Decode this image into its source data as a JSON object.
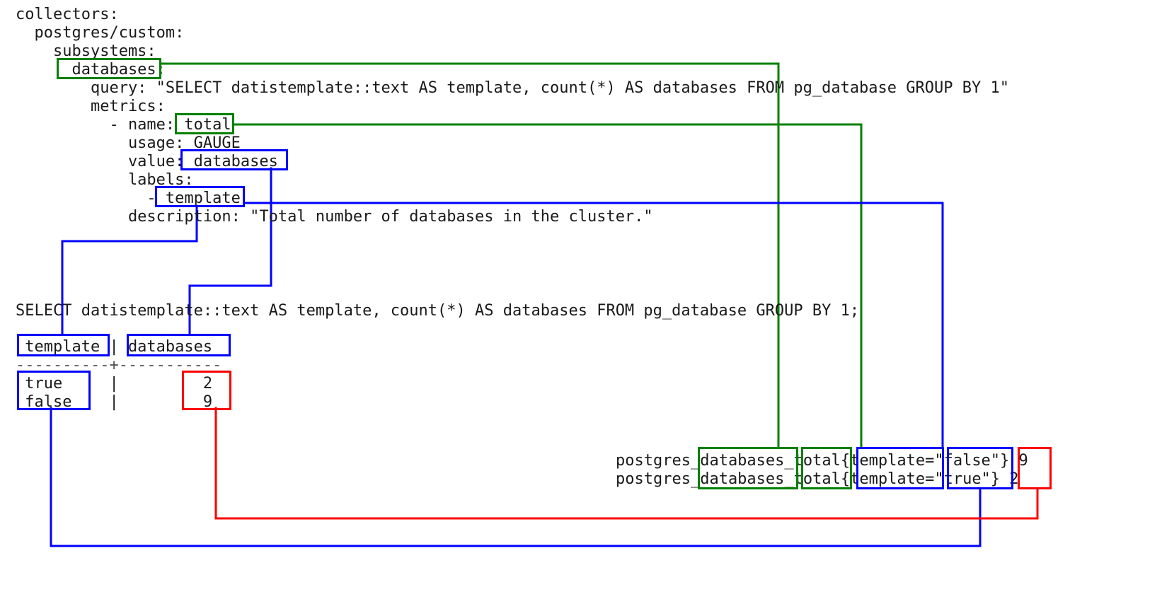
{
  "diagram": {
    "title": "PostgreSQL custom collector YAML to SQL result to Prometheus metric mapping",
    "colors": {
      "green": "#008000",
      "blue": "#0000ff",
      "red": "#ff0000",
      "text": "#1a1a1a",
      "background": "#ffffff"
    }
  },
  "yaml": {
    "lines": [
      "collectors:",
      "  postgres/custom:",
      "    subsystems:",
      "      databases:",
      "        query: \"SELECT datistemplate::text AS template, count(*) AS databases FROM pg_database GROUP BY 1\"",
      "        metrics:",
      "          - name: total",
      "            usage: GAUGE",
      "            value: databases",
      "            labels:",
      "              - template",
      "            description: \"Total number of databases in the cluster.\""
    ]
  },
  "sql": {
    "statement": "SELECT datistemplate::text AS template, count(*) AS databases FROM pg_database GROUP BY 1;",
    "header": " template | databases",
    "separator": "----------+-----------",
    "rows": [
      " true     |         2",
      " false    |         9"
    ],
    "columns": [
      "template",
      "databases"
    ],
    "values": [
      {
        "template": "true",
        "databases": "2"
      },
      {
        "template": "false",
        "databases": "9"
      }
    ]
  },
  "prometheus": {
    "lines": [
      "postgres_databases_total{template=\"false\"} 9",
      "postgres_databases_total{template=\"true\"} 2"
    ]
  },
  "highlights": {
    "subsystem_name": "databases:",
    "metric_name": "total",
    "metric_value": "databases",
    "metric_label": "template",
    "sql_col_template": "template",
    "sql_col_databases": "databases",
    "sql_val_template": "true / false",
    "sql_val_count": "2 / 9",
    "prom_metric_prefix": "databases",
    "prom_metric_suffix": "total",
    "prom_label_key": "template",
    "prom_label_value": "\"false\" / \"true\"",
    "prom_sample_value": "9 / 2"
  }
}
